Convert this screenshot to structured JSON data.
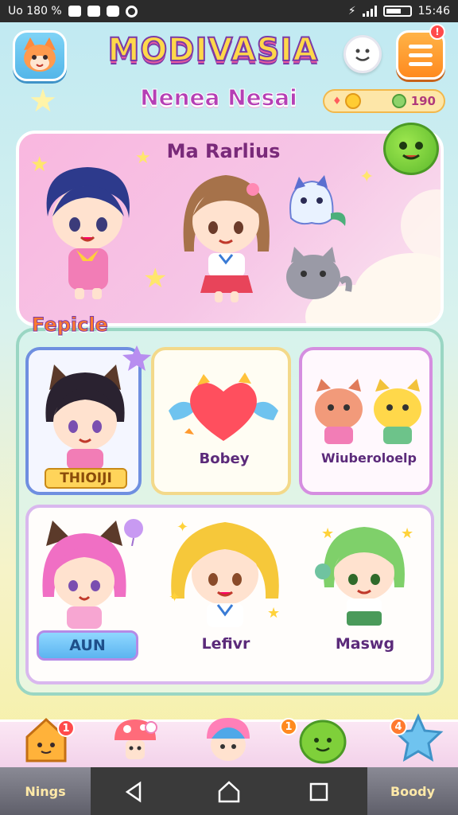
{
  "status_bar": {
    "left_text": "Uo 180 %",
    "time": "15:46",
    "icons": [
      "photo-icon",
      "keyboard-icon",
      "camera-icon",
      "wifi-icon",
      "signal-icon",
      "battery-icon"
    ]
  },
  "header": {
    "app_title": "MODIVASIA",
    "subtitle": "Nenea Nesai",
    "menu_badge": "!",
    "currency": {
      "primary_label": "",
      "secondary_value": "190"
    }
  },
  "banner": {
    "title": "Ma Rarlius",
    "icons": [
      "chibi-boy-blue-hair",
      "chibi-girl-brown-hair",
      "blue-ghost-pet",
      "grey-cat-pet",
      "green-blob-button"
    ]
  },
  "section": {
    "label": "Fepicle",
    "cards": [
      {
        "label": "THIOIJI",
        "icon": "cat-ear-chibi"
      },
      {
        "label": "Bobey",
        "icon": "winged-heart"
      },
      {
        "label": "Wiuberoloelp",
        "icon": "two-pets"
      },
      {
        "label": "AUN",
        "icon": "pink-hair-chibi"
      },
      {
        "label": "Lefivr",
        "icon": "yellow-hair-chibi"
      },
      {
        "label": "Maswg",
        "icon": "green-hair-chibi"
      }
    ]
  },
  "dock": {
    "items": [
      {
        "icon": "house-icon",
        "badge": "1"
      },
      {
        "icon": "mushroom-icon",
        "badge": ""
      },
      {
        "icon": "chibi-face-icon",
        "badge": ""
      },
      {
        "icon": "green-blob-icon",
        "badge": "1"
      },
      {
        "icon": "blue-star-icon",
        "badge": "4"
      }
    ]
  },
  "nav": {
    "left_label": "Nings",
    "right_label": "Boody"
  },
  "colors": {
    "accent_purple": "#7a3aa8",
    "accent_pink": "#f9b7df",
    "badge_red": "#ff4b4b"
  }
}
